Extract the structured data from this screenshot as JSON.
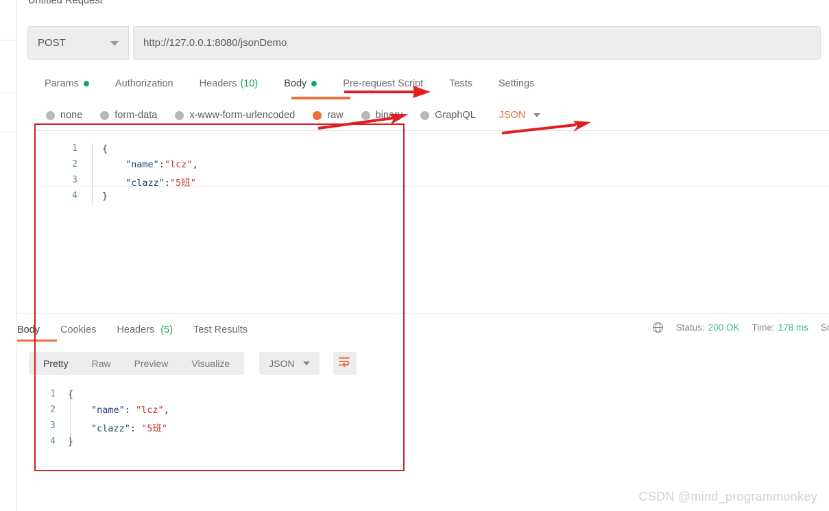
{
  "request": {
    "title": "Untitled Request",
    "method": "POST",
    "url": "http://127.0.0.1:8080/jsonDemo",
    "send_label": "",
    "tabs": [
      {
        "label": "Params",
        "badge": "dot",
        "active": false
      },
      {
        "label": "Authorization",
        "badge": "",
        "active": false
      },
      {
        "label": "Headers",
        "badge": "(10)",
        "active": false
      },
      {
        "label": "Body",
        "badge": "dot",
        "active": true
      },
      {
        "label": "Pre-request Script",
        "badge": "",
        "active": false
      },
      {
        "label": "Tests",
        "badge": "",
        "active": false
      },
      {
        "label": "Settings",
        "badge": "",
        "active": false
      }
    ],
    "body_types": [
      {
        "label": "none",
        "selected": false
      },
      {
        "label": "form-data",
        "selected": false
      },
      {
        "label": "x-www-form-urlencoded",
        "selected": false
      },
      {
        "label": "raw",
        "selected": true
      },
      {
        "label": "binary",
        "selected": false
      },
      {
        "label": "GraphQL",
        "selected": false
      }
    ],
    "raw_format": "JSON",
    "body_lines": [
      {
        "no": "1",
        "indent": 0,
        "tokens": [
          {
            "t": "{",
            "c": "punct"
          }
        ]
      },
      {
        "no": "2",
        "indent": 1,
        "tokens": [
          {
            "t": "\"name\"",
            "c": "key"
          },
          {
            "t": ":",
            "c": "plain"
          },
          {
            "t": "\"lcz\"",
            "c": "val"
          },
          {
            "t": ",",
            "c": "plain"
          }
        ]
      },
      {
        "no": "3",
        "indent": 1,
        "tokens": [
          {
            "t": "\"clazz\"",
            "c": "key"
          },
          {
            "t": ":",
            "c": "plain"
          },
          {
            "t": "\"5班\"",
            "c": "val"
          }
        ]
      },
      {
        "no": "4",
        "indent": 0,
        "tokens": [
          {
            "t": "}",
            "c": "punct"
          }
        ]
      }
    ]
  },
  "response": {
    "tabs": [
      {
        "label": "Body",
        "badge": "",
        "active": true
      },
      {
        "label": "Cookies",
        "badge": "",
        "active": false
      },
      {
        "label": "Headers",
        "badge": "(5)",
        "active": false
      },
      {
        "label": "Test Results",
        "badge": "",
        "active": false
      }
    ],
    "status_label": "Status:",
    "status_value": "200 OK",
    "time_label": "Time:",
    "time_value": "178 ms",
    "size_label": "Si",
    "view_modes": [
      {
        "label": "Pretty",
        "active": true
      },
      {
        "label": "Raw",
        "active": false
      },
      {
        "label": "Preview",
        "active": false
      },
      {
        "label": "Visualize",
        "active": false
      }
    ],
    "format": "JSON",
    "body_lines": [
      {
        "no": "1",
        "indent": 0,
        "tokens": [
          {
            "t": "{",
            "c": "punct"
          }
        ]
      },
      {
        "no": "2",
        "indent": 1,
        "tokens": [
          {
            "t": "\"name\"",
            "c": "key"
          },
          {
            "t": ": ",
            "c": "plain"
          },
          {
            "t": "\"lcz\"",
            "c": "val"
          },
          {
            "t": ",",
            "c": "plain"
          }
        ]
      },
      {
        "no": "3",
        "indent": 1,
        "tokens": [
          {
            "t": "\"clazz\"",
            "c": "key"
          },
          {
            "t": ": ",
            "c": "plain"
          },
          {
            "t": "\"5班\"",
            "c": "val"
          }
        ]
      },
      {
        "no": "4",
        "indent": 0,
        "tokens": [
          {
            "t": "}",
            "c": "punct"
          }
        ]
      }
    ]
  },
  "watermark": "CSDN @mind_programmonkey",
  "colors": {
    "accent_orange": "#f06f37",
    "send_blue": "#1283ed",
    "status_green": "#42b983",
    "annotation_red": "#d32020",
    "json_key": "#1d3f73",
    "json_value": "#c0392b"
  }
}
